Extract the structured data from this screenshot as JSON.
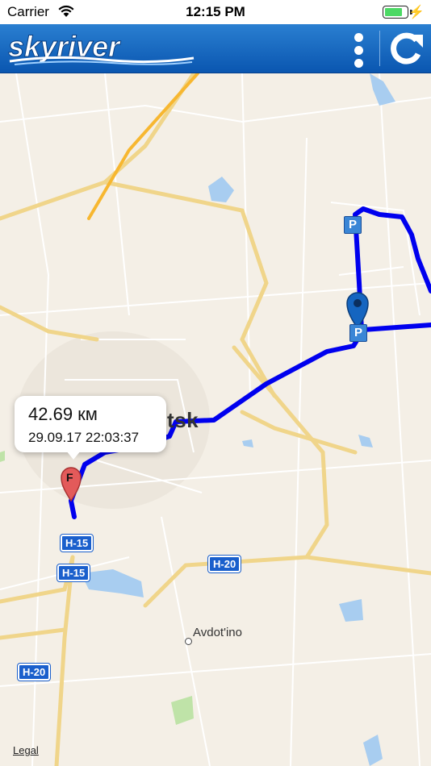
{
  "status_bar": {
    "carrier": "Carrier",
    "time": "12:15 PM",
    "battery_level": 0.8
  },
  "header": {
    "logo_text": "skyriver",
    "menu_icon": "vertical-dots-icon",
    "refresh_icon": "refresh-icon",
    "background_color": "#1a6cc4"
  },
  "map": {
    "city_label": "Donetsk",
    "place_label": "Avdot'ino",
    "road_labels": [
      "H-15",
      "H-15",
      "H-20",
      "H-20"
    ],
    "parking_label": "P",
    "start_marker_label": "F",
    "route_color": "#0000ee",
    "legal": "Legal"
  },
  "callout": {
    "distance": "42.69 км",
    "datetime": "29.09.17 22:03:37"
  }
}
